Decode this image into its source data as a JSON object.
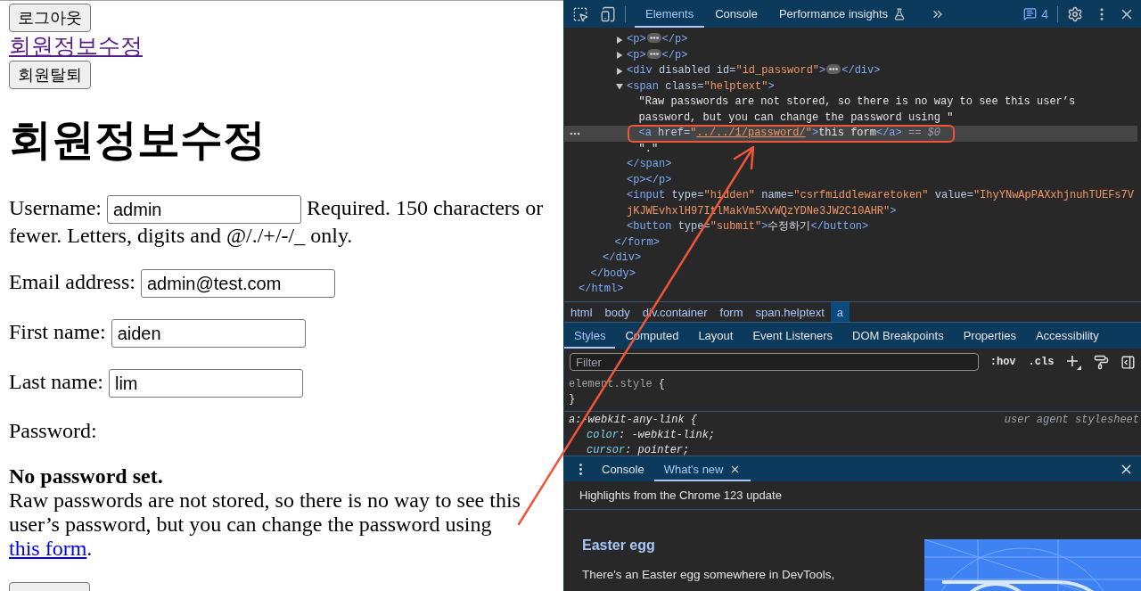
{
  "page": {
    "logout_button": "로그아웃",
    "profile_link": {
      "label": "회원정보수정",
      "visited": true
    },
    "withdraw_button": "회원탈퇴",
    "title": "회원정보수정",
    "fields": [
      {
        "label": "Username:",
        "value": "admin",
        "help_lines": [
          "Required. 150 characters or",
          "fewer. Letters, digits and @/./+/-/_ only."
        ]
      },
      {
        "label": "Email address:",
        "value": "admin@test.com"
      },
      {
        "label": "First name:",
        "value": "aiden"
      },
      {
        "label": "Last name:",
        "value": "lim"
      }
    ],
    "password": {
      "label": "Password:",
      "status": "No password set.",
      "help": "Raw passwords are not stored, so there is no way to see this user’s password, but you can change the password using ",
      "link": {
        "label": "this form",
        "visited": false
      },
      "help_end": "."
    }
  },
  "devtools": {
    "main_tabs": [
      {
        "label": "Elements",
        "selected": true,
        "experimental": false
      },
      {
        "label": "Console",
        "selected": false,
        "experimental": false
      },
      {
        "label": "Performance insights",
        "selected": false,
        "experimental": true
      }
    ],
    "issues_count": "4",
    "tree": [
      {
        "kind": "element",
        "close": "</html>",
        "selected": false,
        "children": [
          {
            "kind": "element",
            "close": "</body>",
            "selected": false,
            "children": [
              {
                "kind": "element",
                "close": "</div>",
                "selected": false,
                "children": [
                  {
                    "kind": "element",
                    "close": "</form>",
                    "selected": false,
                    "children": [
                      {
                        "kind": "element",
                        "open": "<p>",
                        "close": "</p>",
                        "expanded": false,
                        "selected": false
                      },
                      {
                        "kind": "element",
                        "open": "<p>",
                        "close": "</p>",
                        "expanded": false,
                        "selected": false
                      },
                      {
                        "kind": "element",
                        "open": "<div disabled id=\"id_password\">",
                        "close": "</div>",
                        "expanded": false,
                        "selected": false
                      },
                      {
                        "kind": "element",
                        "open": "<span class=\"helptext\">",
                        "close": "</span>",
                        "expanded": true,
                        "selected": false,
                        "children": [
                          {
                            "kind": "text",
                            "text": "\"Raw passwords are not stored, so there is no way to see this user’s password, but you can change the password using \"",
                            "selected": false
                          },
                          {
                            "kind": "element",
                            "open": "<a href=\"../../1/password/\">",
                            "content": "this form",
                            "close": "</a>",
                            "linked": true,
                            "selected": true,
                            "reference": "== $0"
                          },
                          {
                            "kind": "text",
                            "text": "\".\"",
                            "selected": false
                          }
                        ]
                      },
                      {
                        "kind": "element",
                        "open": "<p>",
                        "close": "</p>",
                        "selected": false
                      },
                      {
                        "kind": "void",
                        "open": "<input type=\"hidden\" name=\"csrfmiddlewaretoken\" value=\"IhyYNwApPAXxhjnuhTUEFs7VjKJWEvhxlH97ItlMakVm5XvWQzYDNe3JW2C10AHR\">",
                        "selected": false
                      },
                      {
                        "kind": "element",
                        "open": "<button type=\"submit\">",
                        "content": "수정하기",
                        "close": "</button>",
                        "selected": false
                      }
                    ]
                  }
                ]
              }
            ]
          }
        ]
      }
    ],
    "breadcrumbs": [
      {
        "label": "html",
        "selected": false
      },
      {
        "label": "body",
        "selected": false
      },
      {
        "label": "div.container",
        "selected": false
      },
      {
        "label": "form",
        "selected": false
      },
      {
        "label": "span.helptext",
        "selected": false
      },
      {
        "label": "a",
        "selected": true
      }
    ],
    "sidebar_tabs": [
      {
        "label": "Styles",
        "selected": true
      },
      {
        "label": "Computed",
        "selected": false
      },
      {
        "label": "Layout",
        "selected": false
      },
      {
        "label": "Event Listeners",
        "selected": false
      },
      {
        "label": "DOM Breakpoints",
        "selected": false
      },
      {
        "label": "Properties",
        "selected": false
      },
      {
        "label": "Accessibility",
        "selected": false
      }
    ],
    "filter": {
      "placeholder": "Filter"
    },
    "filter_toggles": [
      ":hov",
      ".cls"
    ],
    "rules": [
      {
        "kind": "inline",
        "selector": "element.style",
        "open_brace": "{",
        "close_brace": "}"
      },
      {
        "kind": "user_agent",
        "selector": "a:-webkit-any-link",
        "open_brace": "{",
        "origin": "user agent stylesheet",
        "declarations": [
          "color: -webkit-link;",
          "cursor: pointer;"
        ]
      }
    ],
    "drawer": {
      "tabs": [
        {
          "label": "Console",
          "selected": false,
          "closable": false
        },
        {
          "label": "What's new",
          "selected": true,
          "closable": true
        }
      ],
      "banner": "Highlights from the Chrome 123 update",
      "article": {
        "title": "Easter egg",
        "text": "There's an Easter egg somewhere in DevTools,"
      }
    }
  }
}
